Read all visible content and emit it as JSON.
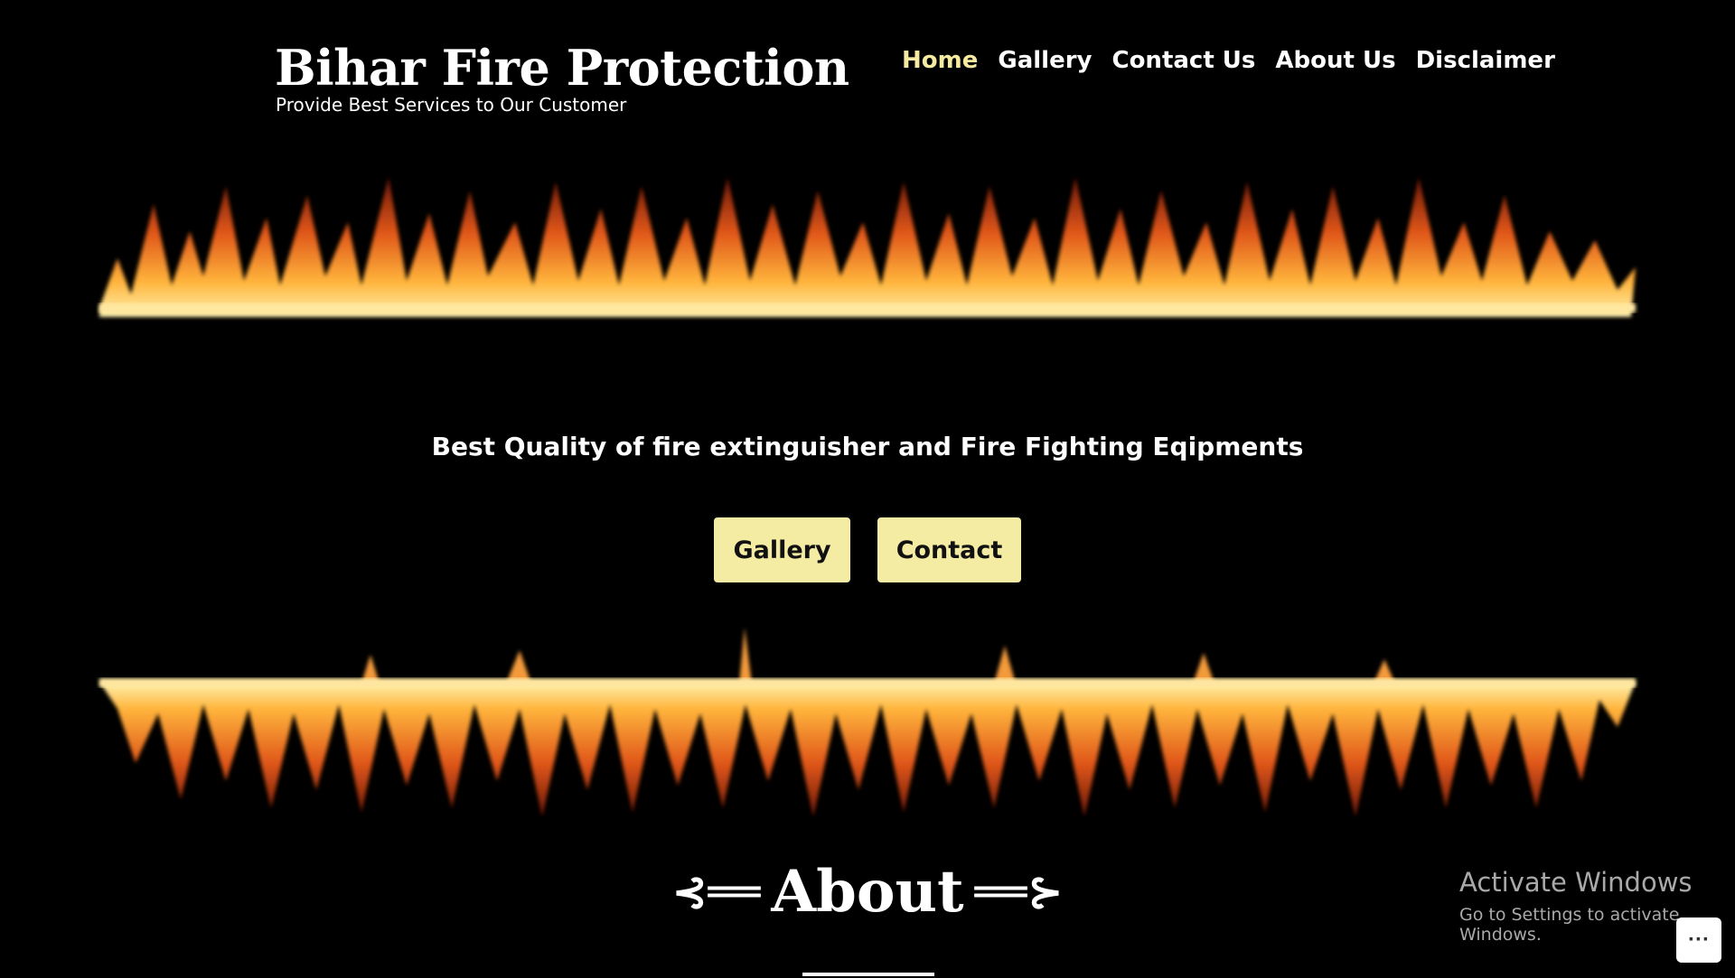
{
  "header": {
    "site_title": "Bihar Fire Protection",
    "tagline": "Provide Best Services to Our Customer"
  },
  "nav": {
    "items": [
      {
        "label": "Home",
        "active": true
      },
      {
        "label": "Gallery"
      },
      {
        "label": "Contact Us"
      },
      {
        "label": "About Us"
      },
      {
        "label": "Disclaimer"
      }
    ]
  },
  "hero": {
    "headline": "Best Quality of fire extinguisher and Fire Fighting Eqipments",
    "buttons": {
      "gallery": "Gallery",
      "contact": "Contact"
    }
  },
  "about": {
    "arrow_left": "⊰══",
    "title": "About",
    "arrow_right": "══⊱"
  },
  "watermark": {
    "title": "Activate Windows",
    "subtitle": "Go to Settings to activate Windows."
  },
  "more_button": {
    "label": "···"
  },
  "colors": {
    "accent": "#f5eaa0",
    "button_bg": "#f5eca3",
    "background": "#000000"
  }
}
